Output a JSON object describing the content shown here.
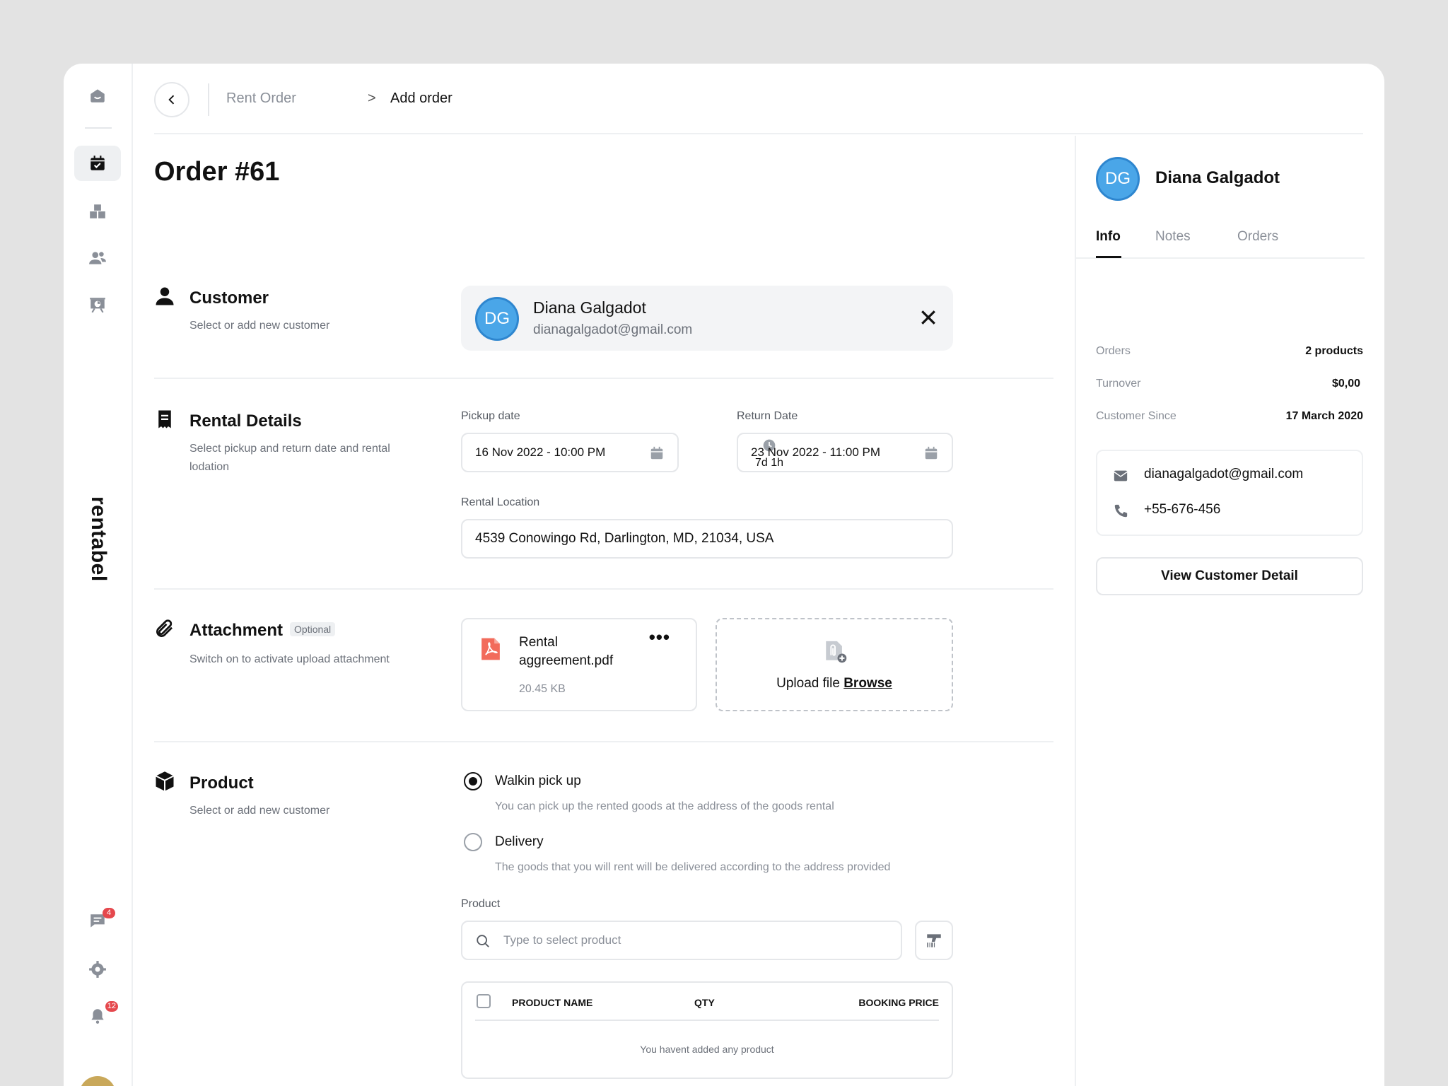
{
  "brand": "rentabel",
  "sidebar": {
    "badges": {
      "messages": "4",
      "notifications": "12"
    }
  },
  "breadcrumb": {
    "parent": "Rent Order",
    "separator": ">",
    "current": "Add order"
  },
  "page_title": "Order #61",
  "customer_section": {
    "title": "Customer",
    "subtitle": "Select or add new customer",
    "selected": {
      "initials": "DG",
      "name": "Diana Galgadot",
      "email": "dianagalgadot@gmail.com"
    }
  },
  "rental_section": {
    "title": "Rental Details",
    "subtitle": "Select pickup and return date and rental lodation",
    "pickup_label": "Pickup date",
    "pickup_value": "16 Nov 2022 - 10:00 PM",
    "duration": "7d 1h",
    "return_label": "Return Date",
    "return_value": "23 Nov 2022 - 11:00 PM",
    "location_label": "Rental Location",
    "location_value": "4539 Conowingo Rd, Darlington, MD, 21034, USA"
  },
  "attachment_section": {
    "title": "Attachment",
    "optional_tag": "Optional",
    "subtitle": "Switch on to activate upload attachment",
    "file": {
      "name": "Rental aggreement.pdf",
      "size": "20.45 KB",
      "menu": "•••"
    },
    "upload_text": "Upload file",
    "upload_link": "Browse"
  },
  "product_section": {
    "title": "Product",
    "subtitle": "Select or add new customer",
    "options": [
      {
        "label": "Walkin pick up",
        "desc": "You can pick up the rented goods at the address of the goods rental",
        "selected": true
      },
      {
        "label": "Delivery",
        "desc": "The goods that you will rent will be delivered according to the address provided",
        "selected": false
      }
    ],
    "product_label": "Product",
    "search_placeholder": "Type to select product",
    "table_headers": [
      "PRODUCT NAME",
      "QTY",
      "BOOKING PRICE"
    ],
    "empty_text": "You havent added any product"
  },
  "right_panel": {
    "initials": "DG",
    "name": "Diana Galgadot",
    "tabs": [
      "Info",
      "Notes",
      "Orders"
    ],
    "info": [
      {
        "key": "Orders",
        "value": "2 products"
      },
      {
        "key": "Turnover",
        "value": "$0,00"
      },
      {
        "key": "Customer Since",
        "value": "17 March 2020"
      }
    ],
    "email": "dianagalgadot@gmail.com",
    "phone": "+55-676-456",
    "view_button": "View Customer Detail"
  },
  "colors": {
    "avatar_bg": "#4aa6e8",
    "badge": "#e5484d",
    "border": "#e5e7ea"
  }
}
